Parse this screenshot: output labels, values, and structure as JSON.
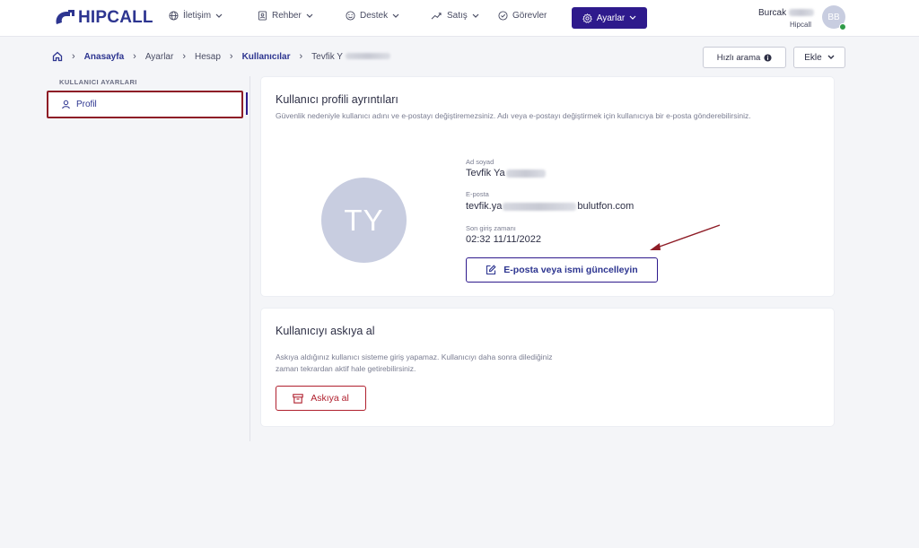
{
  "brand": {
    "name": "HIPCALL",
    "color": "#2d3590"
  },
  "nav": {
    "items": [
      {
        "label": "İletişim",
        "icon": "globe-icon"
      },
      {
        "label": "Rehber",
        "icon": "contact-book-icon"
      },
      {
        "label": "Destek",
        "icon": "smile-icon"
      },
      {
        "label": "Satış",
        "icon": "trend-icon"
      },
      {
        "label": "Görevler",
        "icon": "check-circle-icon"
      }
    ],
    "active": {
      "label": "Ayarlar",
      "icon": "gear-icon",
      "color": "#2e1a8c"
    }
  },
  "user": {
    "name": "Burcak",
    "company": "Hipcall",
    "initials": "BB",
    "status_color": "#2f9a47"
  },
  "breadcrumb": {
    "items": [
      "Anasayfa",
      "Ayarlar",
      "Hesap",
      "Kullanıcılar",
      "Tevfik Y"
    ]
  },
  "actions": {
    "quick_search": "Hızlı arama",
    "add": "Ekle"
  },
  "sidebar": {
    "heading": "KULLANICI AYARLARI",
    "items": [
      {
        "label": "Profil",
        "icon": "user-icon"
      }
    ]
  },
  "profile_card": {
    "title": "Kullanıcı profili ayrıntıları",
    "description": "Güvenlik nedeniyle kullanıcı adını ve e-postayı değiştiremezsiniz. Adı veya e-postayı değiştirmek için kullanıcıya bir e-posta gönderebilirsiniz.",
    "initials": "TY",
    "fields": [
      {
        "label": "Ad soyad",
        "value_prefix": "Tevfik Ya",
        "value_suffix": ""
      },
      {
        "label": "E-posta",
        "value_prefix": "tevfik.ya",
        "value_suffix": "bulutfon.com"
      },
      {
        "label": "Son giriş zamanı",
        "value_prefix": "02:32 11/11/2022",
        "value_suffix": ""
      }
    ],
    "update_button": "E-posta veya ismi güncelleyin"
  },
  "suspend_card": {
    "title": "Kullanıcıyı askıya al",
    "description_line1": "Askıya aldığınız kullanıcı sisteme giriş yapamaz. Kullanıcıyı daha sonra dilediğiniz",
    "description_line2": "zaman tekrardan aktif hale getirebilirsiniz.",
    "button": "Askıya al",
    "color": "#b0202e"
  }
}
